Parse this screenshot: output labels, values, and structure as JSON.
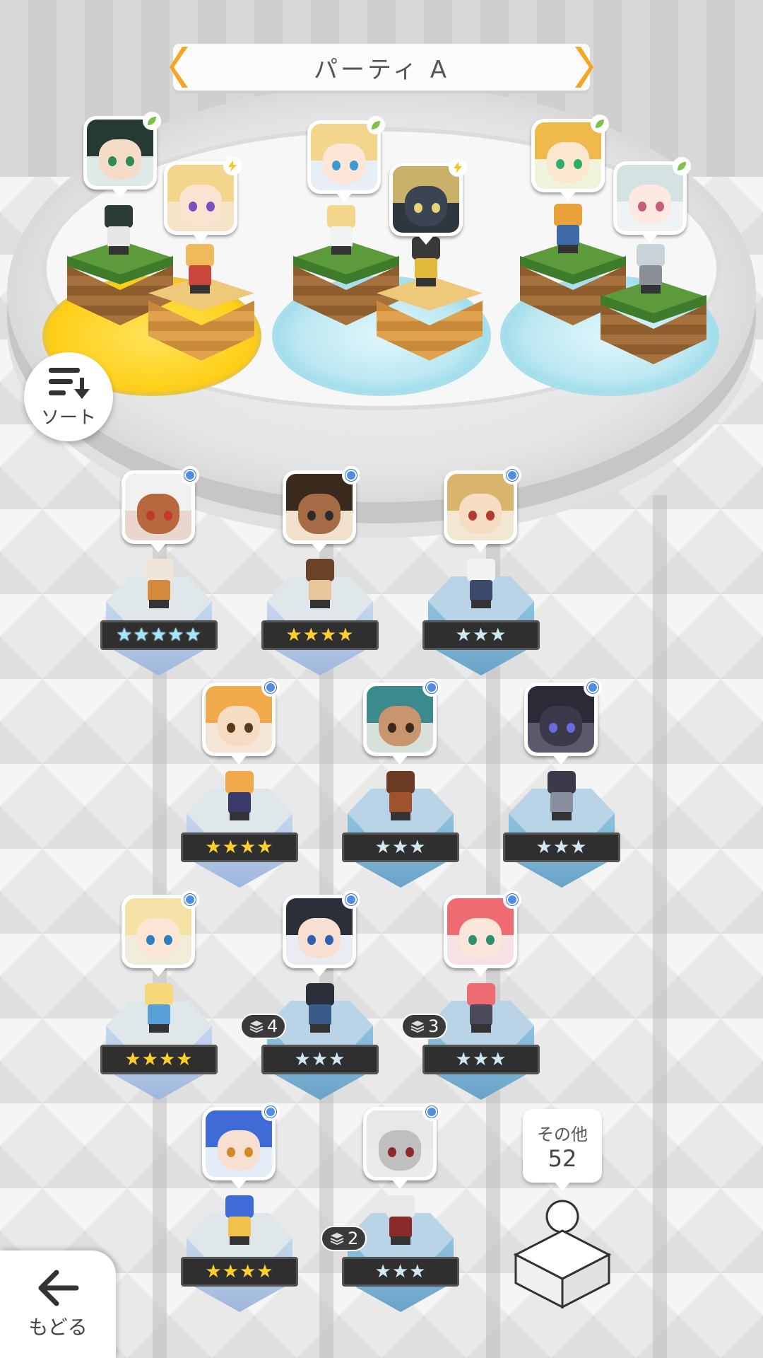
{
  "header": {
    "title": "パーティ A"
  },
  "sort": {
    "label": "ソート"
  },
  "back": {
    "label": "もどる"
  },
  "others": {
    "label": "その他",
    "count": "52"
  },
  "party_slots": [
    {
      "units": [
        {
          "attr": "leaf"
        },
        {
          "attr": "bolt"
        }
      ]
    },
    {
      "units": [
        {
          "attr": "leaf"
        },
        {
          "attr": "bolt"
        }
      ]
    },
    {
      "units": [
        {
          "attr": "leaf"
        },
        {
          "attr": "leaf"
        }
      ]
    }
  ],
  "roster": [
    {
      "stars": "★★★★★",
      "rarity": 5
    },
    {
      "stars": "★★★★",
      "rarity": 4
    },
    {
      "stars": "★★★",
      "rarity": 3
    },
    {
      "stars": "★★★★",
      "rarity": 4
    },
    {
      "stars": "★★★",
      "rarity": 3
    },
    {
      "stars": "★★★",
      "rarity": 3
    },
    {
      "stars": "★★★★",
      "rarity": 4
    },
    {
      "stars": "★★★",
      "rarity": 3,
      "stack": "4"
    },
    {
      "stars": "★★★",
      "rarity": 3,
      "stack": "3"
    },
    {
      "stars": "★★★★",
      "rarity": 4
    },
    {
      "stars": "★★★",
      "rarity": 3,
      "stack": "2"
    }
  ],
  "colors": {
    "accent": "#f5a623",
    "leaf_badge": "#7cc24b",
    "bolt_badge": "#f5c518",
    "new_badge": "#4f8de8"
  },
  "icons": {
    "sort": "sort-icon",
    "back": "arrow-left-icon",
    "leaf": "leaf-icon",
    "bolt": "bolt-icon",
    "stack": "layers-icon"
  }
}
